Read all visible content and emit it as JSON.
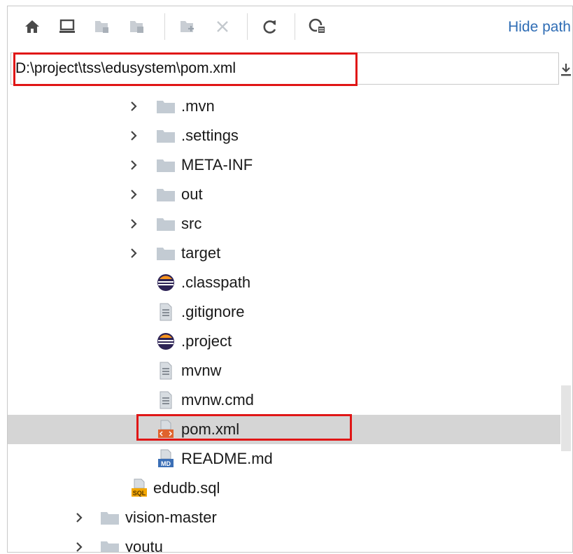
{
  "toolbar": {
    "buttons": [
      {
        "name": "home-icon",
        "enabled": true
      },
      {
        "name": "desktop-icon",
        "enabled": true
      },
      {
        "name": "project-folder-icon",
        "enabled": false
      },
      {
        "name": "module-folder-icon",
        "enabled": false
      },
      {
        "name": "new-folder-icon",
        "enabled": false
      },
      {
        "name": "delete-icon",
        "enabled": false
      },
      {
        "name": "refresh-icon",
        "enabled": true
      },
      {
        "name": "show-hidden-icon",
        "enabled": true
      }
    ],
    "hide_path_label": "Hide path"
  },
  "path": {
    "value": "D:\\project\\tss\\edusystem\\pom.xml"
  },
  "tree": [
    {
      "label": ".mvn",
      "type": "folder",
      "expandable": true
    },
    {
      "label": ".settings",
      "type": "folder",
      "expandable": true
    },
    {
      "label": "META-INF",
      "type": "folder",
      "expandable": true
    },
    {
      "label": "out",
      "type": "folder",
      "expandable": true
    },
    {
      "label": "src",
      "type": "folder",
      "expandable": true
    },
    {
      "label": "target",
      "type": "folder",
      "expandable": true
    },
    {
      "label": ".classpath",
      "type": "eclipse",
      "expandable": false
    },
    {
      "label": ".gitignore",
      "type": "text",
      "expandable": false
    },
    {
      "label": ".project",
      "type": "eclipse",
      "expandable": false
    },
    {
      "label": "mvnw",
      "type": "text",
      "expandable": false
    },
    {
      "label": "mvnw.cmd",
      "type": "text",
      "expandable": false
    },
    {
      "label": "pom.xml",
      "type": "xml",
      "expandable": false,
      "selected": true
    },
    {
      "label": "README.md",
      "type": "md",
      "expandable": false
    },
    {
      "label": "edudb.sql",
      "type": "sql",
      "expandable": false
    },
    {
      "label": "vision-master",
      "type": "folder",
      "expandable": true
    },
    {
      "label": "youtu",
      "type": "folder",
      "expandable": true
    }
  ],
  "colors": {
    "highlight": "#e01616",
    "link": "#2f6db5",
    "selection": "#d5d5d5",
    "folder": "#c3cbd3"
  }
}
